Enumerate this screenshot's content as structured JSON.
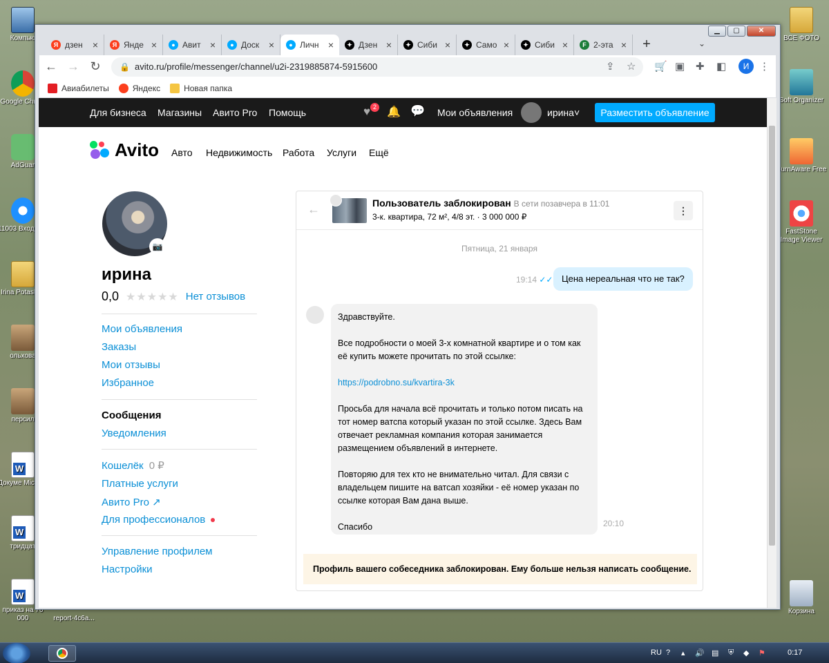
{
  "desktop_left": [
    {
      "label": "Компью",
      "kind": "computer"
    },
    {
      "label": "Google Chrom",
      "kind": "chrome"
    },
    {
      "label": "AdGuar",
      "kind": "adguard"
    },
    {
      "label": "11003 Входящи",
      "kind": "ie"
    },
    {
      "label": "Irina Potashov",
      "kind": "folder"
    },
    {
      "label": "ольхова",
      "kind": "photo"
    },
    {
      "label": "персил",
      "kind": "photo"
    },
    {
      "label": "Докуме Microsc",
      "kind": "word"
    },
    {
      "label": "тридцат",
      "kind": "word"
    },
    {
      "label": "приказ на 76 000",
      "kind": "word"
    }
  ],
  "desktop_bottom_label": "report-4c6a...",
  "desktop_right": [
    {
      "label": "ВСЕ ФОТО",
      "kind": "folder"
    },
    {
      "label": "Soft Organizer",
      "kind": "soft"
    },
    {
      "label": "BurnAware Free",
      "kind": "burn"
    },
    {
      "label": "FastStone Image Viewer",
      "kind": "eye"
    },
    {
      "label": "Корзина",
      "kind": "bin"
    }
  ],
  "browser": {
    "tabs": [
      {
        "title": "дзен",
        "icon": "yandex-icon",
        "color": "#fc3f1d",
        "glyph": "Я"
      },
      {
        "title": "Янде",
        "icon": "yandex-icon",
        "color": "#fc3f1d",
        "glyph": "Я"
      },
      {
        "title": "Авит",
        "icon": "avito-icon",
        "color": "#0af",
        "glyph": "●"
      },
      {
        "title": "Доск",
        "icon": "avito-icon",
        "color": "#0af",
        "glyph": "●"
      },
      {
        "title": "Личн",
        "icon": "avito-icon",
        "color": "#0af",
        "glyph": "●",
        "active": true
      },
      {
        "title": "Дзен",
        "icon": "dzen-icon",
        "color": "#000",
        "glyph": "✦"
      },
      {
        "title": "Сиби",
        "icon": "dzen-icon",
        "color": "#000",
        "glyph": "✦"
      },
      {
        "title": "Само",
        "icon": "dzen-icon",
        "color": "#000",
        "glyph": "✦"
      },
      {
        "title": "Сиби",
        "icon": "dzen-icon",
        "color": "#000",
        "glyph": "✦"
      },
      {
        "title": "2-эта",
        "icon": "f-icon",
        "color": "#1b7d3a",
        "glyph": "F"
      }
    ],
    "url": "avito.ru/profile/messenger/channel/u2i-2319885874-5915600",
    "profile_letter": "И",
    "bookmarks": [
      "Авиабилеты",
      "Яндекс",
      "Новая папка"
    ]
  },
  "avito": {
    "topbar": {
      "links": [
        "Для бизнеса",
        "Магазины",
        "Авито Pro",
        "Помощь"
      ],
      "fav_badge": "2",
      "my_ads": "Мои объявления",
      "user": "ирина",
      "post_button": "Разместить объявление"
    },
    "logo": "Avito",
    "categories": [
      "Авто",
      "Недвижимость",
      "Работа",
      "Услуги",
      "Ещё"
    ],
    "profile": {
      "name": "ирина",
      "rating": "0,0",
      "reviews_link": "Нет отзывов"
    },
    "menu": {
      "my_ads": "Мои объявления",
      "orders": "Заказы",
      "my_reviews": "Мои отзывы",
      "favorites": "Избранное",
      "messages": "Сообщения",
      "notifications": "Уведомления",
      "wallet": "Кошелёк",
      "wallet_value": "0 ₽",
      "paid_services": "Платные услуги",
      "avito_pro": "Авито Pro ↗",
      "for_pros": "Для профессионалов",
      "profile_settings": "Управление профилем",
      "settings": "Настройки"
    },
    "chat": {
      "title": "Пользователь заблокирован",
      "status": "В сети позавчера в 11:01",
      "item": "3-к. квартира, 72 м², 4/8 эт. · 3 000 000 ₽",
      "date": "Пятница, 21 января",
      "outgoing": {
        "time": "19:14",
        "text": "Цена нереальная что не так?"
      },
      "incoming": {
        "time": "20:10",
        "paragraphs": [
          "Здравствуйте.",
          "Все подробности о моей 3-х комнатной квартире и о том как её купить можете прочитать по этой ссылке:",
          "https://podrobno.su/kvartira-3k",
          "Просьба для начала всё прочитать и только потом писать на тот номер ватспа который указан по этой ссылке. Здесь Вам отвечает рекламная компания которая занимается размещением объявлений в интернете.",
          "Повторяю для тех кто не внимательно читал. Для связи с владельцем пишите на ватсап хозяйки - её номер указан по ссылке которая Вам дана выше.",
          "Спасибо"
        ]
      },
      "blocked_notice": "Профиль вашего собеседника заблокирован. Ему больше нельзя написать сообщение."
    }
  },
  "taskbar": {
    "lang": "RU",
    "clock": "0:17"
  }
}
